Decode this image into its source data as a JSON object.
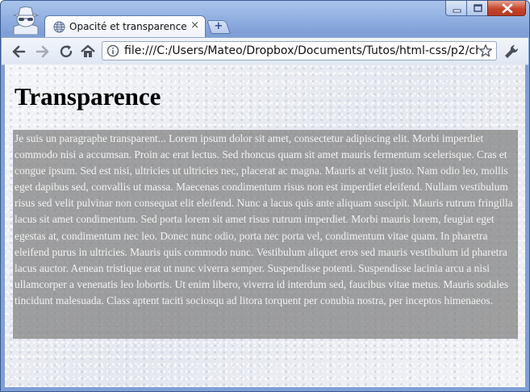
{
  "window": {
    "tab_title": "Opacité et transparence",
    "tab_close": "×",
    "new_tab": "+"
  },
  "toolbar": {
    "url": "file:///C:/Users/Mateo/Dropbox/Documents/Tutos/html-css/p2/ch"
  },
  "page": {
    "heading": "Transparence",
    "paragraph": "Je suis un paragraphe transparent... Lorem ipsum dolor sit amet, consectetur adipiscing elit. Morbi imperdiet commodo nisi a accumsan. Proin ac erat lectus. Sed rhoncus quam sit amet mauris fermentum scelerisque. Cras et congue ipsum. Sed est nisi, ultricies ut ultricies nec, placerat ac magna. Mauris at velit justo. Nam odio leo, mollis eget dapibus sed, convallis ut massa. Maecenas condimentum risus non est imperdiet eleifend. Nullam vestibulum risus sed velit pulvinar non consequat elit eleifend. Nunc a lacus quis ante aliquam suscipit. Mauris rutrum fringilla lacus sit amet condimentum. Sed porta lorem sit amet risus rutrum imperdiet. Morbi mauris lorem, feugiat eget egestas at, condimentum nec leo. Donec nunc odio, porta nec porta vel, condimentum vitae quam. In pharetra eleifend purus in ultricies. Mauris quis commodo nunc. Vestibulum aliquet eros sed mauris vestibulum id pharetra lacus auctor. Aenean tristique erat ut nunc viverra semper. Suspendisse potenti. Suspendisse lacinia arcu a nisi ullamcorper a venenatis leo lobortis. Ut enim libero, viverra id interdum sed, faucibus vitae metus. Mauris sodales tincidunt malesuada. Class aptent taciti sociosqu ad litora torquent per conubia nostra, per inceptos himenaeos."
  },
  "icons": {
    "incognito": "incognito-icon",
    "favicon": "globe-icon",
    "back": "back-arrow-icon",
    "forward": "forward-arrow-icon",
    "reload": "reload-icon",
    "home": "home-icon",
    "page": "page-icon",
    "bookmark": "star-icon",
    "menu": "wrench-icon"
  },
  "colors": {
    "frame": "#7f9fd6",
    "paragraph_bg": "#7e7e7e",
    "paragraph_text": "#f2f2f2"
  }
}
